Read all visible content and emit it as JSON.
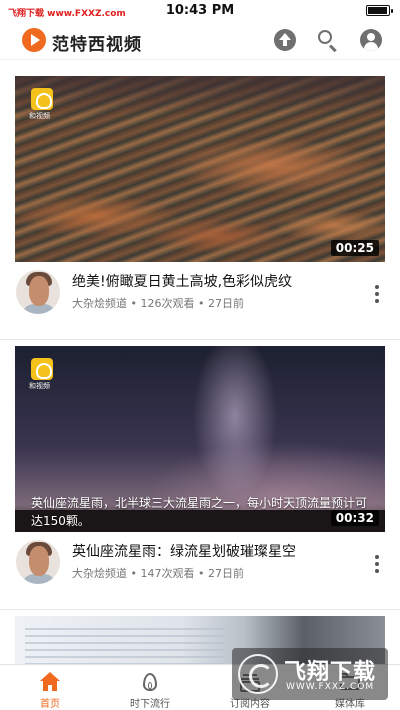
{
  "status_bar": {
    "watermark": "飞翔下载 www.FXXZ.com",
    "time": "10:43 PM"
  },
  "app": {
    "title": "范特西视频",
    "accent_color": "#ef6a1f",
    "header_icons": [
      "upload-icon",
      "search-icon",
      "account-icon"
    ]
  },
  "videos": [
    {
      "thumbnail_badge": "和视频",
      "caption": "",
      "duration": "00:25",
      "title": "绝美!俯瞰夏日黄土高坡,色彩似虎纹",
      "channel": "大杂烩频道",
      "views": "126次观看",
      "age": "27日前"
    },
    {
      "thumbnail_badge": "和视频",
      "caption": "英仙座流星雨，北半球三大流星雨之一，每小时天顶流量预计可达150颗。",
      "duration": "00:32",
      "title": "英仙座流星雨：绿流星划破璀璨星空",
      "channel": "大杂烩频道",
      "views": "147次观看",
      "age": "27日前"
    }
  ],
  "tabs": [
    {
      "label": "首页",
      "icon": "home-icon",
      "active": true
    },
    {
      "label": "时下流行",
      "icon": "flame-icon",
      "active": false
    },
    {
      "label": "订阅内容",
      "icon": "subscriptions-icon",
      "active": false
    },
    {
      "label": "媒体库",
      "icon": "library-icon",
      "active": false
    }
  ],
  "bottom_watermark": {
    "title": "飞翔下载",
    "url": "WWW.FXXZ.COM"
  }
}
